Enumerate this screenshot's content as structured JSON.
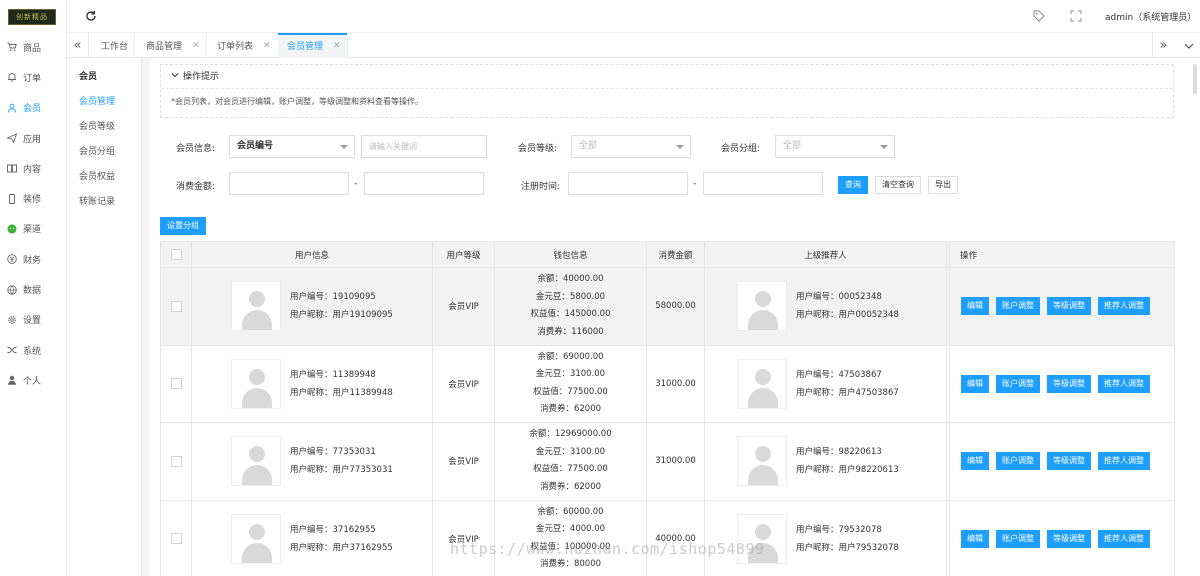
{
  "logo_text": "创新精品",
  "sidebar": [
    {
      "label": "商品",
      "icon": "cart-icon"
    },
    {
      "label": "订单",
      "icon": "bell-icon"
    },
    {
      "label": "会员",
      "icon": "user-icon"
    },
    {
      "label": "应用",
      "icon": "send-icon"
    },
    {
      "label": "内容",
      "icon": "book-icon"
    },
    {
      "label": "装修",
      "icon": "phone-icon"
    },
    {
      "label": "渠道",
      "icon": "wechat-icon"
    },
    {
      "label": "财务",
      "icon": "yen-icon"
    },
    {
      "label": "数据",
      "icon": "globe-icon"
    },
    {
      "label": "设置",
      "icon": "gear-icon"
    },
    {
      "label": "系统",
      "icon": "shuffle-icon"
    },
    {
      "label": "个人",
      "icon": "person-icon"
    }
  ],
  "topbar": {
    "user": "admin（系统管理员）"
  },
  "tabs": [
    {
      "label": "工作台"
    },
    {
      "label": "商品管理"
    },
    {
      "label": "订单列表"
    },
    {
      "label": "会员管理"
    }
  ],
  "subnav": {
    "title": "会员",
    "items": [
      "会员管理",
      "会员等级",
      "会员分组",
      "会员权益",
      "转账记录"
    ]
  },
  "tips": {
    "title": "操作提示",
    "text": "*会员列表，对会员进行编辑，账户调整，等级调整和资料查看等操作。"
  },
  "filters": {
    "member_info_label": "会员信息:",
    "member_info_select": "会员编号",
    "keyword_placeholder": "请输入关键词",
    "level_label": "会员等级:",
    "level_value": "全部",
    "group_label": "会员分组:",
    "group_value": "全部",
    "spend_label": "消费金额:",
    "register_label": "注册时间:",
    "dash": "-",
    "search_btn": "查询",
    "clear_btn": "清空查询",
    "export_btn": "导出"
  },
  "set_group_btn": "设置分组",
  "table": {
    "headers": [
      "用户信息",
      "用户等级",
      "钱包信息",
      "消费金额",
      "上级推荐人",
      "操作"
    ],
    "ops": [
      "编辑",
      "账户调整",
      "等级调整",
      "推荐人调整"
    ],
    "rows": [
      {
        "user_no": "用户编号：19109095",
        "user_nick": "用户昵称：用户19109095",
        "level": "会员VIP",
        "balance": "余额：40000.00",
        "gold": "金元豆：5800.00",
        "equity": "权益值：145000.00",
        "coupon": "消费券：116000",
        "spend": "58000.00",
        "ref_no": "用户编号：00052348",
        "ref_nick": "用户昵称：用户00052348"
      },
      {
        "user_no": "用户编号：11389948",
        "user_nick": "用户昵称：用户11389948",
        "level": "会员VIP",
        "balance": "余额：69000.00",
        "gold": "金元豆：3100.00",
        "equity": "权益值：77500.00",
        "coupon": "消费券：62000",
        "spend": "31000.00",
        "ref_no": "用户编号：47503867",
        "ref_nick": "用户昵称：用户47503867"
      },
      {
        "user_no": "用户编号：77353031",
        "user_nick": "用户昵称：用户77353031",
        "level": "会员VIP",
        "balance": "余额：12969000.00",
        "gold": "金元豆：3100.00",
        "equity": "权益值：77500.00",
        "coupon": "消费券：62000",
        "spend": "31000.00",
        "ref_no": "用户编号：98220613",
        "ref_nick": "用户昵称：用户98220613"
      },
      {
        "user_no": "用户编号：37162955",
        "user_nick": "用户昵称：用户37162955",
        "level": "会员VIP",
        "balance": "余额：60000.00",
        "gold": "金元豆：4000.00",
        "equity": "权益值：100000.00",
        "coupon": "消费券：80000",
        "spend": "40000.00",
        "ref_no": "用户编号：79532078",
        "ref_nick": "用户昵称：用户79532078"
      }
    ]
  },
  "watermark": "https://www.huzhan.com/ishop54899"
}
